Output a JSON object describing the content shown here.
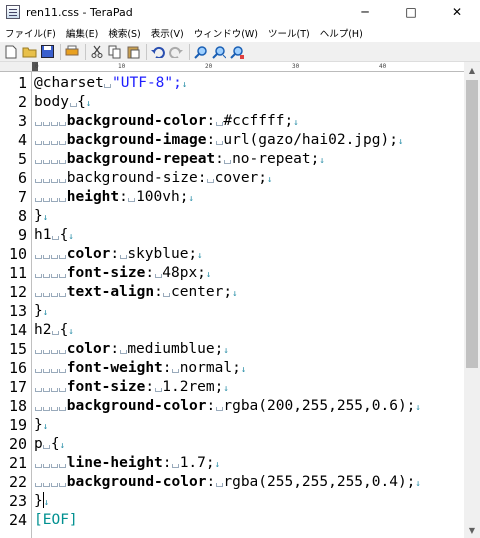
{
  "window": {
    "title": "ren11.css - TeraPad",
    "minimize": "─",
    "maximize": "□",
    "close": "✕"
  },
  "menu": [
    "ファイル(F)",
    "編集(E)",
    "検索(S)",
    "表示(V)",
    "ウィンドウ(W)",
    "ツール(T)",
    "ヘルプ(H)"
  ],
  "ruler": {
    "marks": [
      "0",
      "10",
      "20",
      "30",
      "40"
    ]
  },
  "lines": [
    "1",
    "2",
    "3",
    "4",
    "5",
    "6",
    "7",
    "8",
    "9",
    "10",
    "11",
    "12",
    "13",
    "14",
    "15",
    "16",
    "17",
    "18",
    "19",
    "20",
    "21",
    "22",
    "23",
    "24"
  ],
  "code": {
    "l1": {
      "kw": "@charset",
      "val": "\"UTF-8\";"
    },
    "l2": {
      "sel": "body",
      "brace": "{"
    },
    "l3": {
      "prop": "background-color",
      "val": "#ccffff;"
    },
    "l4": {
      "prop": "background-image",
      "val": "url(gazo/hai02.jpg);"
    },
    "l5": {
      "prop": "background-repeat",
      "val": "no-repeat;"
    },
    "l6": {
      "prop": "background-size",
      "val": "cover;"
    },
    "l7": {
      "prop": "height",
      "val": "100vh;"
    },
    "l8": {
      "brace": "}"
    },
    "l9": {
      "sel": "h1",
      "brace": "{"
    },
    "l10": {
      "prop": "color",
      "val": "skyblue;"
    },
    "l11": {
      "prop": "font-size",
      "val": "48px;"
    },
    "l12": {
      "prop": "text-align",
      "val": "center;"
    },
    "l13": {
      "brace": "}"
    },
    "l14": {
      "sel": "h2",
      "brace": "{"
    },
    "l15": {
      "prop": "color",
      "val": "mediumblue;"
    },
    "l16": {
      "prop": "font-weight",
      "val": "normal;"
    },
    "l17": {
      "prop": "font-size",
      "val": "1.2rem;"
    },
    "l18": {
      "prop": "background-color",
      "val": "rgba(200,255,255,0.6);"
    },
    "l19": {
      "brace": "}"
    },
    "l20": {
      "sel": "p",
      "brace": "{"
    },
    "l21": {
      "prop": "line-height",
      "val": "1.7;"
    },
    "l22": {
      "prop": "background-color",
      "val": "rgba(255,255,255,0.4);"
    },
    "l23": {
      "brace": "}"
    },
    "l24": {
      "eof": "[EOF]"
    }
  },
  "colors": {
    "string": "#2020ff",
    "eof": "#009090",
    "marker": "#2b8fa8"
  }
}
